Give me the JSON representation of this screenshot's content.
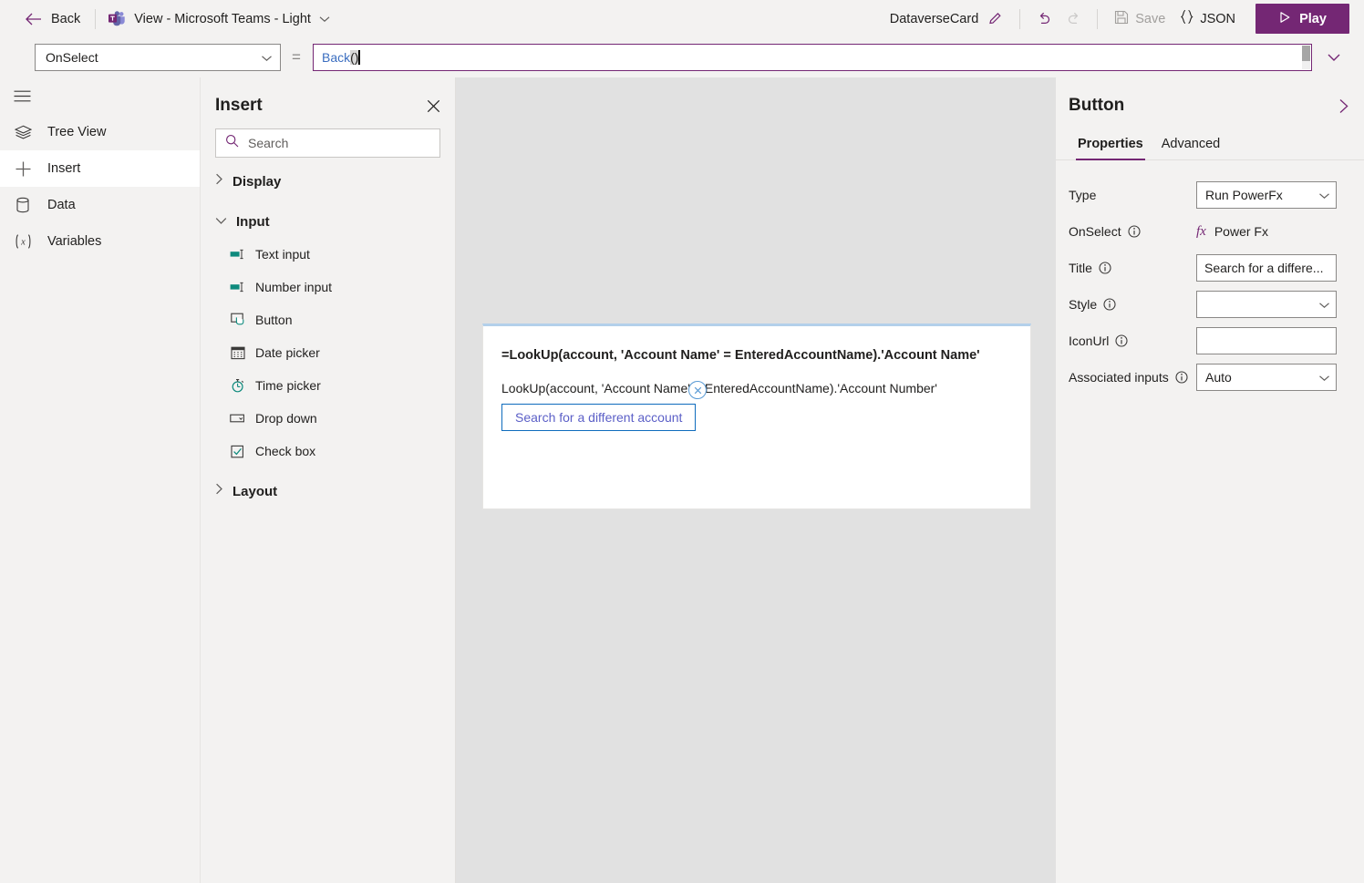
{
  "topbar": {
    "back_label": "Back",
    "view_title": "View - Microsoft Teams - Light",
    "card_name": "DataverseCard",
    "save_label": "Save",
    "json_label": "JSON",
    "play_label": "Play",
    "brand_color": "#742774"
  },
  "formula": {
    "property": "OnSelect",
    "equals": "=",
    "expression_fn": "Back",
    "expression_parens": "()"
  },
  "rail": {
    "items": [
      {
        "label": "Tree View",
        "icon": "layers-icon",
        "active": false
      },
      {
        "label": "Insert",
        "icon": "plus-icon",
        "active": true
      },
      {
        "label": "Data",
        "icon": "database-icon",
        "active": false
      },
      {
        "label": "Variables",
        "icon": "variables-icon",
        "active": false
      }
    ]
  },
  "insert_panel": {
    "title": "Insert",
    "search_placeholder": "Search",
    "groups": [
      {
        "label": "Display",
        "expanded": false,
        "items": []
      },
      {
        "label": "Input",
        "expanded": true,
        "items": [
          {
            "label": "Text input",
            "icon": "text-input-icon"
          },
          {
            "label": "Number input",
            "icon": "number-input-icon"
          },
          {
            "label": "Button",
            "icon": "button-icon"
          },
          {
            "label": "Date picker",
            "icon": "calendar-icon"
          },
          {
            "label": "Time picker",
            "icon": "clock-icon"
          },
          {
            "label": "Drop down",
            "icon": "dropdown-icon"
          },
          {
            "label": "Check box",
            "icon": "checkbox-icon"
          }
        ]
      },
      {
        "label": "Layout",
        "expanded": false,
        "items": []
      }
    ]
  },
  "canvas": {
    "card": {
      "line1": "=LookUp(account, 'Account Name' = EnteredAccountName).'Account Name'",
      "line2": "LookUp(account, 'Account Name' = EnteredAccountName).'Account Number'",
      "button_label": "Search for a different account"
    }
  },
  "right_panel": {
    "title": "Button",
    "tabs": [
      {
        "label": "Properties",
        "active": true
      },
      {
        "label": "Advanced",
        "active": false
      }
    ],
    "fields": [
      {
        "label": "Type",
        "info": false,
        "kind": "dropdown",
        "value": "Run PowerFx"
      },
      {
        "label": "OnSelect",
        "info": true,
        "kind": "fx",
        "value": "Power Fx"
      },
      {
        "label": "Title",
        "info": true,
        "kind": "text",
        "value": "Search for a differe..."
      },
      {
        "label": "Style",
        "info": true,
        "kind": "dropdown",
        "value": ""
      },
      {
        "label": "IconUrl",
        "info": true,
        "kind": "text",
        "value": ""
      },
      {
        "label": "Associated inputs",
        "info": true,
        "kind": "dropdown",
        "value": "Auto"
      }
    ]
  }
}
